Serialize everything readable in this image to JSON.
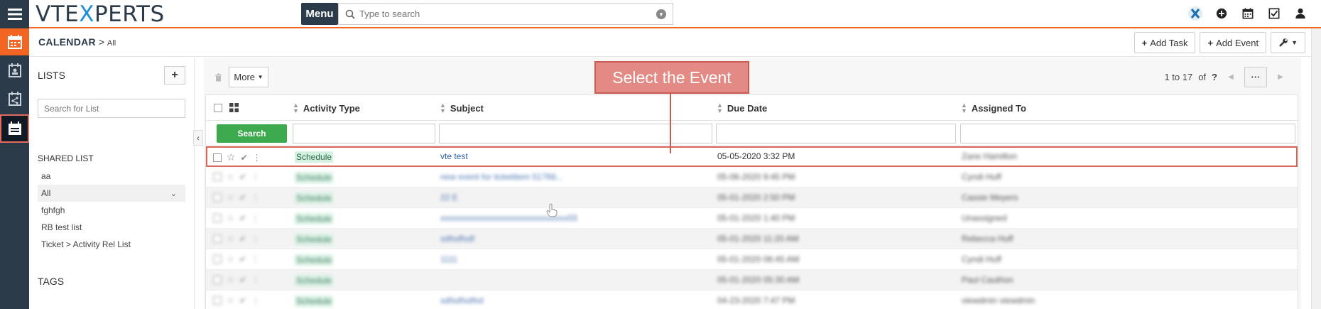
{
  "header": {
    "logo_prefix": "VTE",
    "logo_x": "X",
    "logo_suffix": "PERTS",
    "menu_label": "Menu",
    "search_placeholder": "Type to search"
  },
  "breadcrumb": {
    "module": "Calendar",
    "separator": ">",
    "view": "All"
  },
  "actions": {
    "add_task": "Add Task",
    "add_event": "Add Event"
  },
  "lists_panel": {
    "title": "LISTS",
    "add_label": "+",
    "search_placeholder": "Search for List",
    "shared_title": "SHARED LIST",
    "items": [
      {
        "label": "aa"
      },
      {
        "label": "All",
        "active": true
      },
      {
        "label": "fghfgh"
      },
      {
        "label": "RB test list"
      },
      {
        "label": "Ticket > Activity Rel List"
      }
    ],
    "tags_title": "TAGS"
  },
  "toolbar": {
    "more_label": "More",
    "pager_range": "1 to 17",
    "pager_of": "of",
    "pager_total": "?"
  },
  "table": {
    "columns": [
      "Activity Type",
      "Subject",
      "Due Date",
      "Assigned To"
    ],
    "search_label": "Search",
    "rows": [
      {
        "type": "Schedule",
        "subject": "vte test",
        "due": "05-05-2020 3:32 PM",
        "assigned": "Zane Hamilton",
        "highlight": true
      },
      {
        "type": "Schedule",
        "subject": "new event for ticketitem 51766...",
        "due": "05-06-2020 9:45 PM",
        "assigned": "Cyndi Huff"
      },
      {
        "type": "Schedule",
        "subject": "22 E",
        "due": "05-01-2020 2:50 PM",
        "assigned": "Cassie Meyers"
      },
      {
        "type": "Schedule",
        "subject": "xxxxxxxxxxxxxxxxxxxxxxxxxxxxxx55",
        "due": "05-01-2020 1:40 PM",
        "assigned": "Unassigned"
      },
      {
        "type": "Schedule",
        "subject": "sdfsdfsdf",
        "due": "05-01-2020 11:20 AM",
        "assigned": "Rebecca Huff"
      },
      {
        "type": "Schedule",
        "subject": "1111",
        "due": "05-01-2020 06:45 AM",
        "assigned": "Cyndi Huff"
      },
      {
        "type": "Schedule",
        "subject": "",
        "due": "05-01-2020 05:30 AM",
        "assigned": "Paul Cauthon"
      },
      {
        "type": "Schedule",
        "subject": "sdfsdfsdfsd",
        "due": "04-23-2020 7:47 PM",
        "assigned": "viewdmin viewdmin"
      }
    ]
  },
  "callout": {
    "text": "Select the Event"
  },
  "colors": {
    "accent": "#f26522",
    "sidebar": "#2c3b49",
    "highlight": "#d9675a",
    "search_button": "#3daa4d"
  }
}
